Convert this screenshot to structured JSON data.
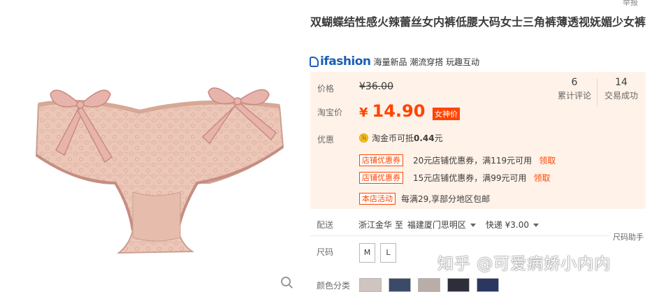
{
  "header": {
    "report_label": "举报"
  },
  "product": {
    "title": "双蝴蝶结性感火辣蕾丝女内裤低腰大码女士三角裤薄透视妩媚少女裤",
    "brand_logo": "ifashion",
    "brand_tags": "海量新品 潮流穿搭 玩趣互动"
  },
  "price": {
    "orig_label": "价格",
    "orig_value": "¥36.00",
    "cur_label": "淘宝价",
    "cur_symbol": "¥",
    "cur_value": "14.90",
    "vip_tag": "女神价"
  },
  "stats": [
    {
      "num": "6",
      "label": "累计评论"
    },
    {
      "num": "14",
      "label": "交易成功"
    }
  ],
  "promo": {
    "label": "优惠",
    "coin_text": "淘金币可抵",
    "coin_amount": "0.44",
    "coin_unit": "元",
    "coupons": [
      {
        "tag": "店铺优惠券",
        "text": "20元店铺优惠券，满119元可用",
        "claim": "领取"
      },
      {
        "tag": "店铺优惠券",
        "text": "15元店铺优惠券，满99元可用",
        "claim": "领取"
      }
    ],
    "activity_tag": "本店活动",
    "activity_text": "每满29,享部分地区包邮"
  },
  "shipping": {
    "label": "配送",
    "from": "浙江金华 至",
    "to": "福建厦门思明区",
    "method": "快递 ¥3.00"
  },
  "size": {
    "label": "尺码",
    "help": "尺码助手",
    "options": [
      "M",
      "L"
    ]
  },
  "color": {
    "label": "颜色分类"
  },
  "watermark": "知乎 @可爱病娇小内内",
  "colors": {
    "accent": "#ff4400",
    "price_bg": "#fff2e8",
    "brand": "#1a5fb4",
    "product": "#e9c2b3"
  }
}
